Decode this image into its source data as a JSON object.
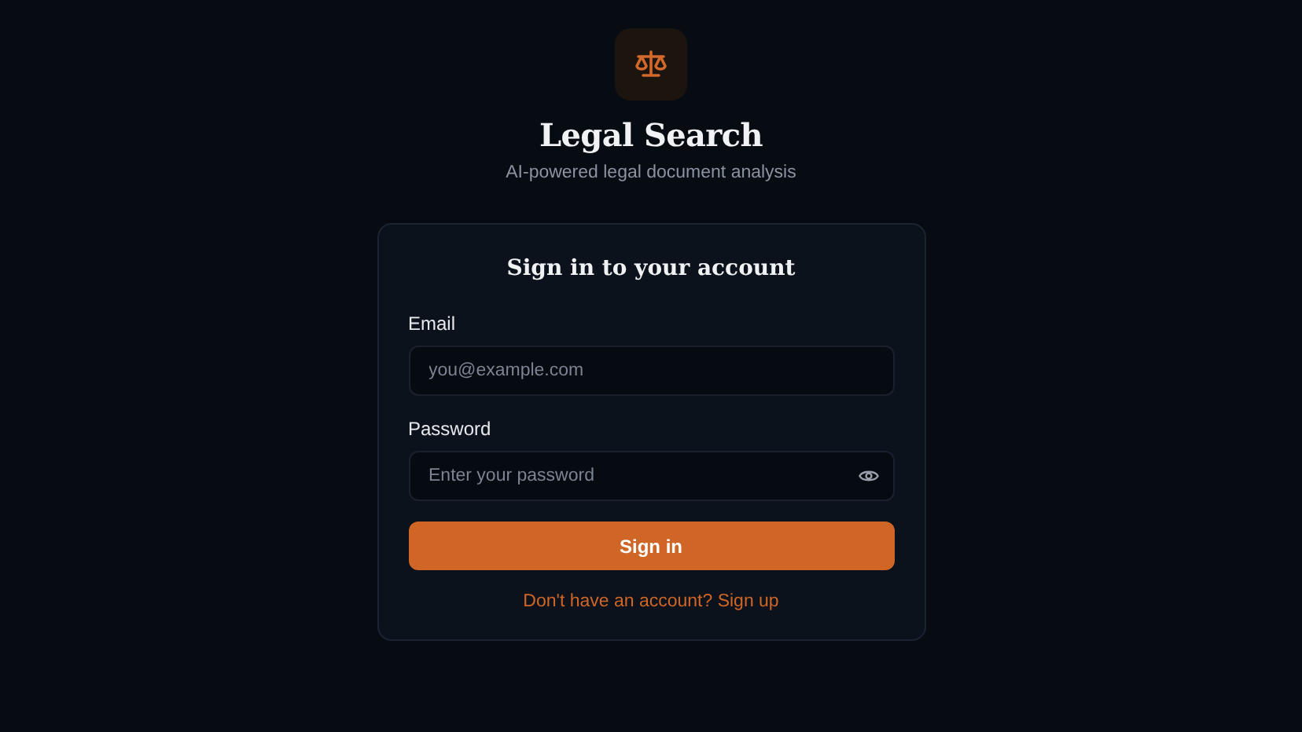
{
  "brand": {
    "title": "Legal Search",
    "subtitle": "AI-powered legal document analysis"
  },
  "form": {
    "heading": "Sign in to your account",
    "fields": [
      {
        "kind": "email",
        "label": "Email",
        "placeholder": "you@example.com"
      },
      {
        "kind": "password",
        "label": "Password",
        "placeholder": "Enter your password"
      }
    ],
    "submit": "Sign in",
    "signup_link": "Don't have an account? Sign up"
  }
}
